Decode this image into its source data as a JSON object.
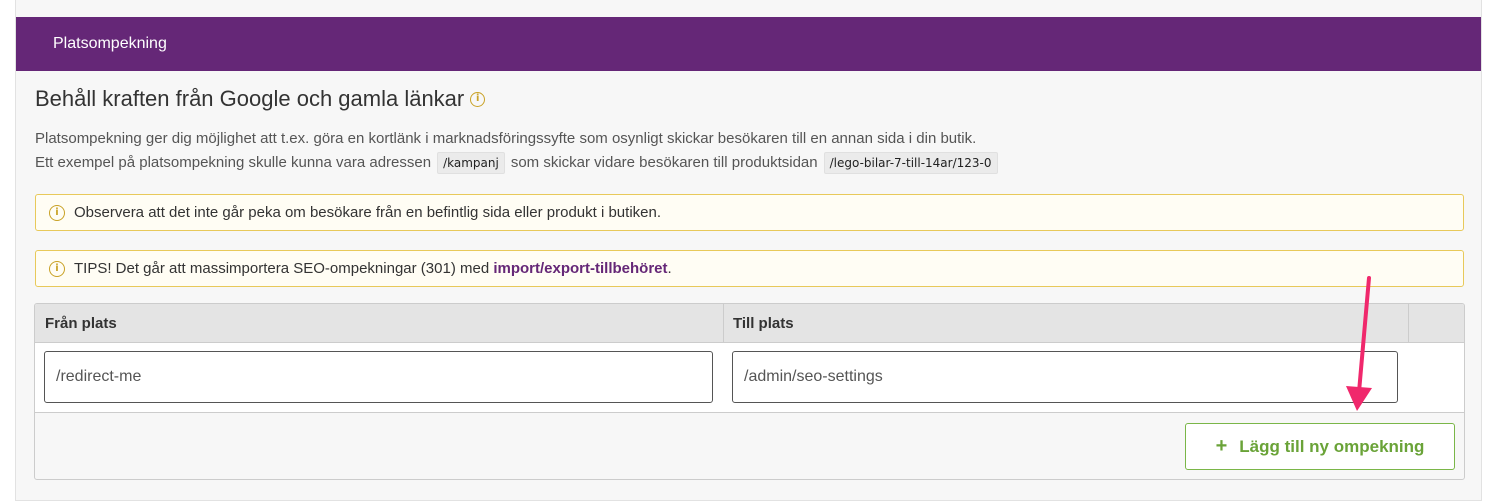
{
  "panel": {
    "header_title": "Platsompekning",
    "heading": "Behåll kraften från Google och gamla länkar",
    "description_line1": "Platsompekning ger dig möjlighet att t.ex. göra en kortlänk i marknadsföringssyfte som osynligt skickar besökaren till en annan sida i din butik.",
    "description_line2_a": "Ett exempel på platsompekning skulle kunna vara adressen",
    "example_from": "/kampanj",
    "description_line2_b": "som skickar vidare besökaren till produktsidan",
    "example_to": "/lego-bilar-7-till-14ar/123-0"
  },
  "alerts": {
    "notice": "Observera att det inte går peka om besökare från en befintlig sida eller produkt i butiken.",
    "tip_prefix": "TIPS! Det går att massimportera SEO-ompekningar (301) med",
    "tip_link": "import/export-tillbehöret",
    "tip_suffix": "."
  },
  "table": {
    "col_from": "Från plats",
    "col_to": "Till plats",
    "row": {
      "from_value": "/redirect-me",
      "to_value": "/admin/seo-settings"
    },
    "add_button_icon": "+",
    "add_button_label": "Lägg till ny ompekning"
  },
  "icons": {
    "info": "info-circle-icon",
    "plus": "plus-icon",
    "annotation": "pink-arrow-icon"
  },
  "colors": {
    "header_purple": "#652777",
    "alert_border": "#e8c95a",
    "button_green": "#6aa338",
    "arrow_pink": "#f0286c"
  }
}
